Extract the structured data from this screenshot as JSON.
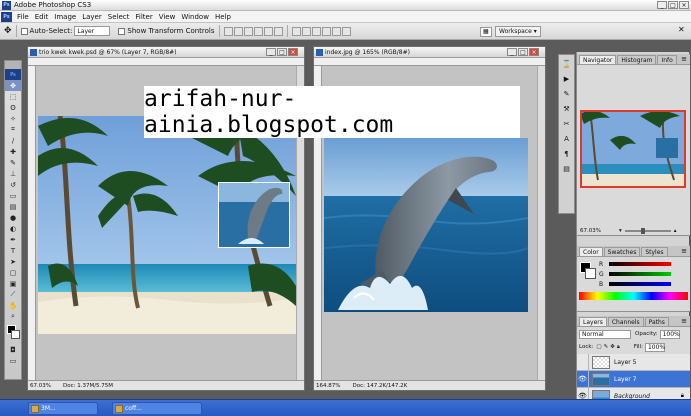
{
  "app": {
    "title": "Adobe Photoshop CS3",
    "logo": "Ps"
  },
  "menu": [
    "File",
    "Edit",
    "Image",
    "Layer",
    "Select",
    "Filter",
    "View",
    "Window",
    "Help"
  ],
  "options": {
    "auto_select_label": "Auto-Select:",
    "auto_select_value": "Layer",
    "show_transform_label": "Show Transform Controls",
    "workspace_label": "Workspace"
  },
  "documents": [
    {
      "title": "trio kwek kwek.psd @ 67% (Layer 7, RGB/8#)",
      "zoom": "67.03%",
      "doc_info": "Doc: 1.37M/5.75M"
    },
    {
      "title": "index.jpg @ 165% (RGB/8#)",
      "zoom": "164.87%",
      "doc_info": "Doc: 147.2K/147.2K"
    }
  ],
  "watermark": "arifah-nur-ainia.blogspot.com",
  "panels": {
    "navigator_tabs": [
      "Navigator",
      "Histogram",
      "Info"
    ],
    "navigator_zoom": "67.03%",
    "color_tabs": [
      "Color",
      "Swatches",
      "Styles"
    ],
    "color_channels": [
      "R",
      "G",
      "B"
    ],
    "layers_tabs": [
      "Layers",
      "Channels",
      "Paths"
    ],
    "blend_mode": "Normal",
    "opacity_label": "Opacity:",
    "opacity_value": "100%",
    "lock_label": "Lock:",
    "fill_label": "Fill:",
    "fill_value": "100%",
    "layers": [
      {
        "name": "Layer 5",
        "active": false
      },
      {
        "name": "Layer 7",
        "active": true
      },
      {
        "name": "Background",
        "active": false
      }
    ]
  },
  "taskbar": [
    {
      "label": "3M..."
    },
    {
      "label": "coff..."
    }
  ],
  "colors": {
    "selection_blue": "#3d73d4",
    "taskbar_blue": "#245ac4",
    "nav_proxy_red": "#e0392b"
  }
}
